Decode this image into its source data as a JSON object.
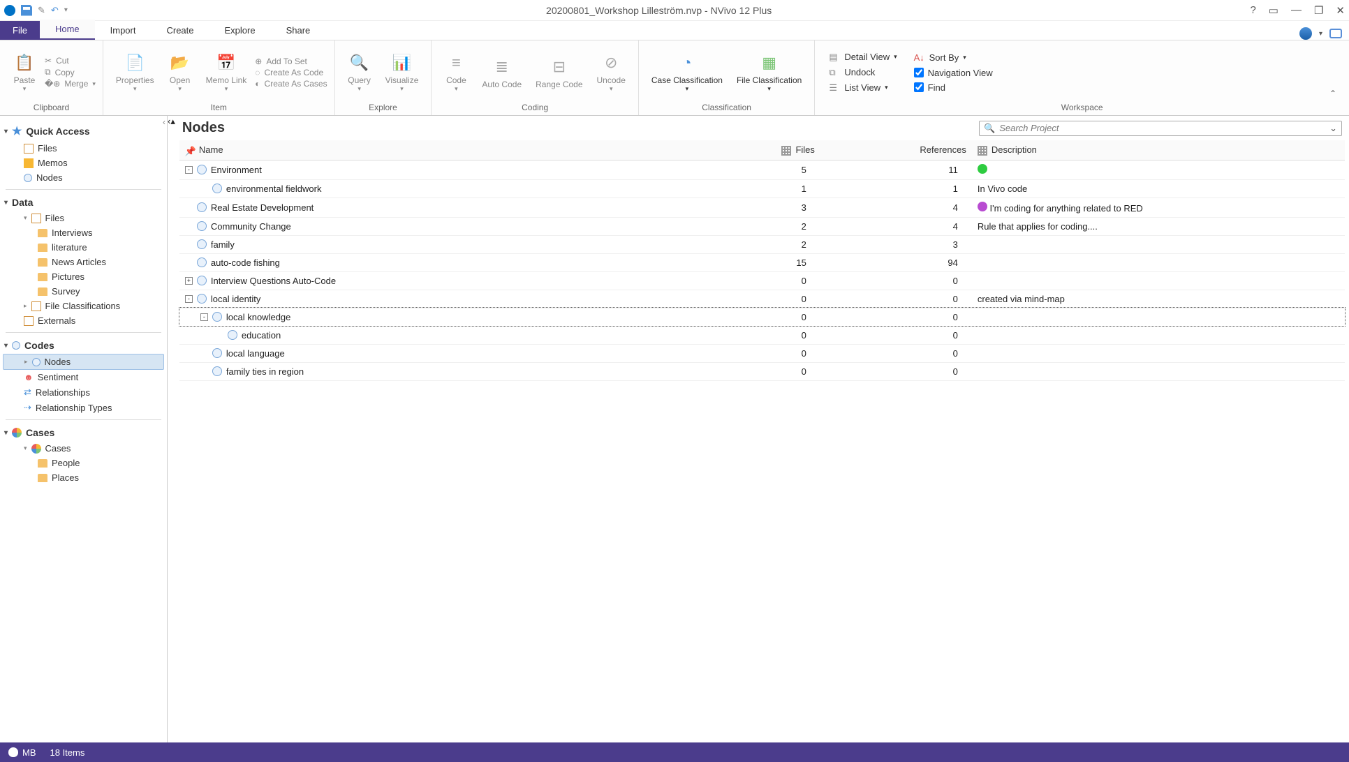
{
  "title": "20200801_Workshop Lilleström.nvp - NVivo 12 Plus",
  "tabs": {
    "file": "File",
    "home": "Home",
    "import": "Import",
    "create": "Create",
    "explore": "Explore",
    "share": "Share"
  },
  "ribbon": {
    "clipboard": {
      "paste": "Paste",
      "cut": "Cut",
      "copy": "Copy",
      "merge": "Merge",
      "label": "Clipboard"
    },
    "item": {
      "properties": "Properties",
      "open": "Open",
      "memolink": "Memo Link",
      "addtoset": "Add To Set",
      "createcode": "Create As Code",
      "createcases": "Create As Cases",
      "label": "Item"
    },
    "explore": {
      "query": "Query",
      "visualize": "Visualize",
      "label": "Explore"
    },
    "coding": {
      "code": "Code",
      "autocode": "Auto Code",
      "rangecode": "Range Code",
      "uncode": "Uncode",
      "label": "Coding"
    },
    "classification": {
      "case": "Case Classification",
      "file": "File Classification",
      "label": "Classification"
    },
    "workspace": {
      "detail": "Detail View",
      "sort": "Sort By",
      "undock": "Undock",
      "nav": "Navigation View",
      "list": "List View",
      "find": "Find",
      "label": "Workspace"
    }
  },
  "nav": {
    "quickaccess": {
      "head": "Quick Access",
      "files": "Files",
      "memos": "Memos",
      "nodes": "Nodes"
    },
    "data": {
      "head": "Data",
      "files": "Files",
      "interviews": "Interviews",
      "literature": "literature",
      "news": "News Articles",
      "pictures": "Pictures",
      "survey": "Survey",
      "fileclass": "File Classifications",
      "externals": "Externals"
    },
    "codes": {
      "head": "Codes",
      "nodes": "Nodes",
      "sentiment": "Sentiment",
      "relationships": "Relationships",
      "reltypes": "Relationship Types"
    },
    "cases": {
      "head": "Cases",
      "cases": "Cases",
      "people": "People",
      "places": "Places"
    }
  },
  "main": {
    "heading": "Nodes",
    "search_placeholder": "Search Project",
    "columns": {
      "name": "Name",
      "files": "Files",
      "refs": "References",
      "desc": "Description"
    },
    "rows": [
      {
        "exp": "-",
        "indent": 0,
        "name": "Environment",
        "files": 5,
        "refs": 11,
        "color": "#2ecc40",
        "desc": ""
      },
      {
        "exp": "",
        "indent": 1,
        "name": "environmental fieldwork",
        "files": 1,
        "refs": 1,
        "color": "",
        "desc": "In Vivo code"
      },
      {
        "exp": "",
        "indent": 0,
        "name": "Real Estate Development",
        "files": 3,
        "refs": 4,
        "color": "#b84bd1",
        "desc": "I'm coding for anything related to RED"
      },
      {
        "exp": "",
        "indent": 0,
        "name": "Community Change",
        "files": 2,
        "refs": 4,
        "color": "",
        "desc": "Rule that applies for coding...."
      },
      {
        "exp": "",
        "indent": 0,
        "name": "family",
        "files": 2,
        "refs": 3,
        "color": "",
        "desc": ""
      },
      {
        "exp": "",
        "indent": 0,
        "name": "auto-code fishing",
        "files": 15,
        "refs": 94,
        "color": "",
        "desc": ""
      },
      {
        "exp": "+",
        "indent": 0,
        "name": "Interview Questions Auto-Code",
        "files": 0,
        "refs": 0,
        "color": "",
        "desc": ""
      },
      {
        "exp": "-",
        "indent": 0,
        "name": "local identity",
        "files": 0,
        "refs": 0,
        "color": "",
        "desc": "created via  mind-map"
      },
      {
        "exp": "-",
        "indent": 1,
        "name": "local knowledge",
        "files": 0,
        "refs": 0,
        "color": "",
        "desc": "",
        "selected": true
      },
      {
        "exp": "",
        "indent": 2,
        "name": "education",
        "files": 0,
        "refs": 0,
        "color": "",
        "desc": ""
      },
      {
        "exp": "",
        "indent": 1,
        "name": "local language",
        "files": 0,
        "refs": 0,
        "color": "",
        "desc": ""
      },
      {
        "exp": "",
        "indent": 1,
        "name": "family ties in region",
        "files": 0,
        "refs": 0,
        "color": "",
        "desc": ""
      }
    ]
  },
  "status": {
    "user": "MB",
    "items": "18 Items"
  }
}
